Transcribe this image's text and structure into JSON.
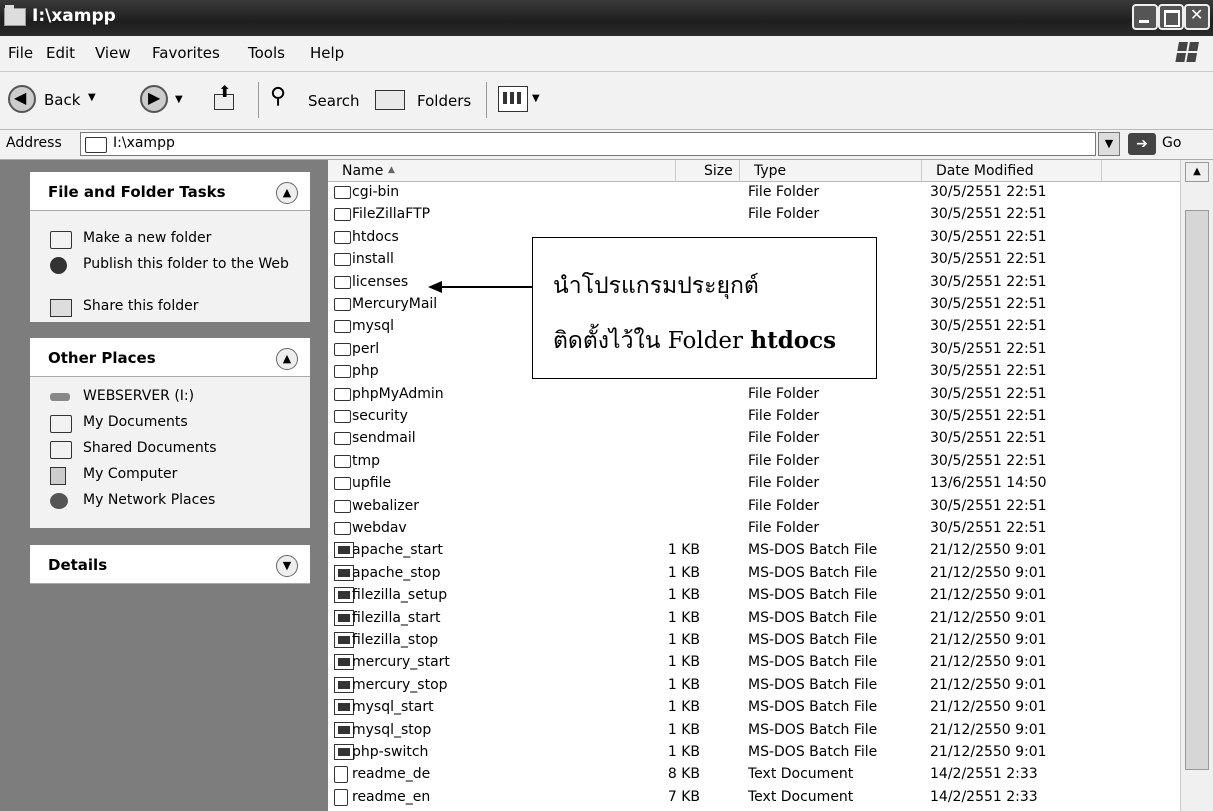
{
  "window": {
    "title": "I:\\xampp"
  },
  "menu": [
    "File",
    "Edit",
    "View",
    "Favorites",
    "Tools",
    "Help"
  ],
  "toolbar": {
    "back": "Back",
    "search": "Search",
    "folders": "Folders"
  },
  "address": {
    "label": "Address",
    "value": "I:\\xampp",
    "go": "Go"
  },
  "tasks_panel": {
    "title": "File and Folder Tasks",
    "items": [
      {
        "label": "Make a new folder",
        "icon": "new-folder-icon"
      },
      {
        "label": "Publish this folder to the Web",
        "icon": "globe-icon"
      },
      {
        "label": "Share this folder",
        "icon": "share-folder-icon"
      }
    ]
  },
  "places_panel": {
    "title": "Other Places",
    "items": [
      {
        "label": "WEBSERVER (I:)",
        "icon": "drive-icon"
      },
      {
        "label": "My Documents",
        "icon": "documents-icon"
      },
      {
        "label": "Shared Documents",
        "icon": "shared-folder-icon"
      },
      {
        "label": "My Computer",
        "icon": "computer-icon"
      },
      {
        "label": "My Network Places",
        "icon": "network-icon"
      }
    ]
  },
  "details_panel": {
    "title": "Details"
  },
  "columns": {
    "name": "Name",
    "size": "Size",
    "type": "Type",
    "date": "Date Modified"
  },
  "files": [
    {
      "name": "cgi-bin",
      "size": "",
      "type": "File Folder",
      "date": "30/5/2551 22:51",
      "kind": "folder"
    },
    {
      "name": "FileZillaFTP",
      "size": "",
      "type": "File Folder",
      "date": "30/5/2551 22:51",
      "kind": "folder"
    },
    {
      "name": "htdocs",
      "size": "",
      "type": "",
      "date": "30/5/2551 22:51",
      "kind": "folder"
    },
    {
      "name": "install",
      "size": "",
      "type": "",
      "date": "30/5/2551 22:51",
      "kind": "folder"
    },
    {
      "name": "licenses",
      "size": "",
      "type": "",
      "date": "30/5/2551 22:51",
      "kind": "folder"
    },
    {
      "name": "MercuryMail",
      "size": "",
      "type": "",
      "date": "30/5/2551 22:51",
      "kind": "folder"
    },
    {
      "name": "mysql",
      "size": "",
      "type": "",
      "date": "30/5/2551 22:51",
      "kind": "folder"
    },
    {
      "name": "perl",
      "size": "",
      "type": "",
      "date": "30/5/2551 22:51",
      "kind": "folder"
    },
    {
      "name": "php",
      "size": "",
      "type": "",
      "date": "30/5/2551 22:51",
      "kind": "folder"
    },
    {
      "name": "phpMyAdmin",
      "size": "",
      "type": "File Folder",
      "date": "30/5/2551 22:51",
      "kind": "folder"
    },
    {
      "name": "security",
      "size": "",
      "type": "File Folder",
      "date": "30/5/2551 22:51",
      "kind": "folder"
    },
    {
      "name": "sendmail",
      "size": "",
      "type": "File Folder",
      "date": "30/5/2551 22:51",
      "kind": "folder"
    },
    {
      "name": "tmp",
      "size": "",
      "type": "File Folder",
      "date": "30/5/2551 22:51",
      "kind": "folder"
    },
    {
      "name": "upfile",
      "size": "",
      "type": "File Folder",
      "date": "13/6/2551 14:50",
      "kind": "folder"
    },
    {
      "name": "webalizer",
      "size": "",
      "type": "File Folder",
      "date": "30/5/2551 22:51",
      "kind": "folder"
    },
    {
      "name": "webdav",
      "size": "",
      "type": "File Folder",
      "date": "30/5/2551 22:51",
      "kind": "folder"
    },
    {
      "name": "apache_start",
      "size": "1 KB",
      "type": "MS-DOS Batch File",
      "date": "21/12/2550 9:01",
      "kind": "bat"
    },
    {
      "name": "apache_stop",
      "size": "1 KB",
      "type": "MS-DOS Batch File",
      "date": "21/12/2550 9:01",
      "kind": "bat"
    },
    {
      "name": "filezilla_setup",
      "size": "1 KB",
      "type": "MS-DOS Batch File",
      "date": "21/12/2550 9:01",
      "kind": "bat"
    },
    {
      "name": "filezilla_start",
      "size": "1 KB",
      "type": "MS-DOS Batch File",
      "date": "21/12/2550 9:01",
      "kind": "bat"
    },
    {
      "name": "filezilla_stop",
      "size": "1 KB",
      "type": "MS-DOS Batch File",
      "date": "21/12/2550 9:01",
      "kind": "bat"
    },
    {
      "name": "mercury_start",
      "size": "1 KB",
      "type": "MS-DOS Batch File",
      "date": "21/12/2550 9:01",
      "kind": "bat"
    },
    {
      "name": "mercury_stop",
      "size": "1 KB",
      "type": "MS-DOS Batch File",
      "date": "21/12/2550 9:01",
      "kind": "bat"
    },
    {
      "name": "mysql_start",
      "size": "1 KB",
      "type": "MS-DOS Batch File",
      "date": "21/12/2550 9:01",
      "kind": "bat"
    },
    {
      "name": "mysql_stop",
      "size": "1 KB",
      "type": "MS-DOS Batch File",
      "date": "21/12/2550 9:01",
      "kind": "bat"
    },
    {
      "name": "php-switch",
      "size": "1 KB",
      "type": "MS-DOS Batch File",
      "date": "21/12/2550 9:01",
      "kind": "bat"
    },
    {
      "name": "readme_de",
      "size": "8 KB",
      "type": "Text Document",
      "date": "14/2/2551 2:33",
      "kind": "txt"
    },
    {
      "name": "readme_en",
      "size": "7 KB",
      "type": "Text Document",
      "date": "14/2/2551 2:33",
      "kind": "txt"
    }
  ],
  "annotation": {
    "line1": "นำโปรแกรมประยุกต์",
    "line2": "ติดตั้งไว้ใน Folder",
    "line2_bold": "htdocs"
  }
}
